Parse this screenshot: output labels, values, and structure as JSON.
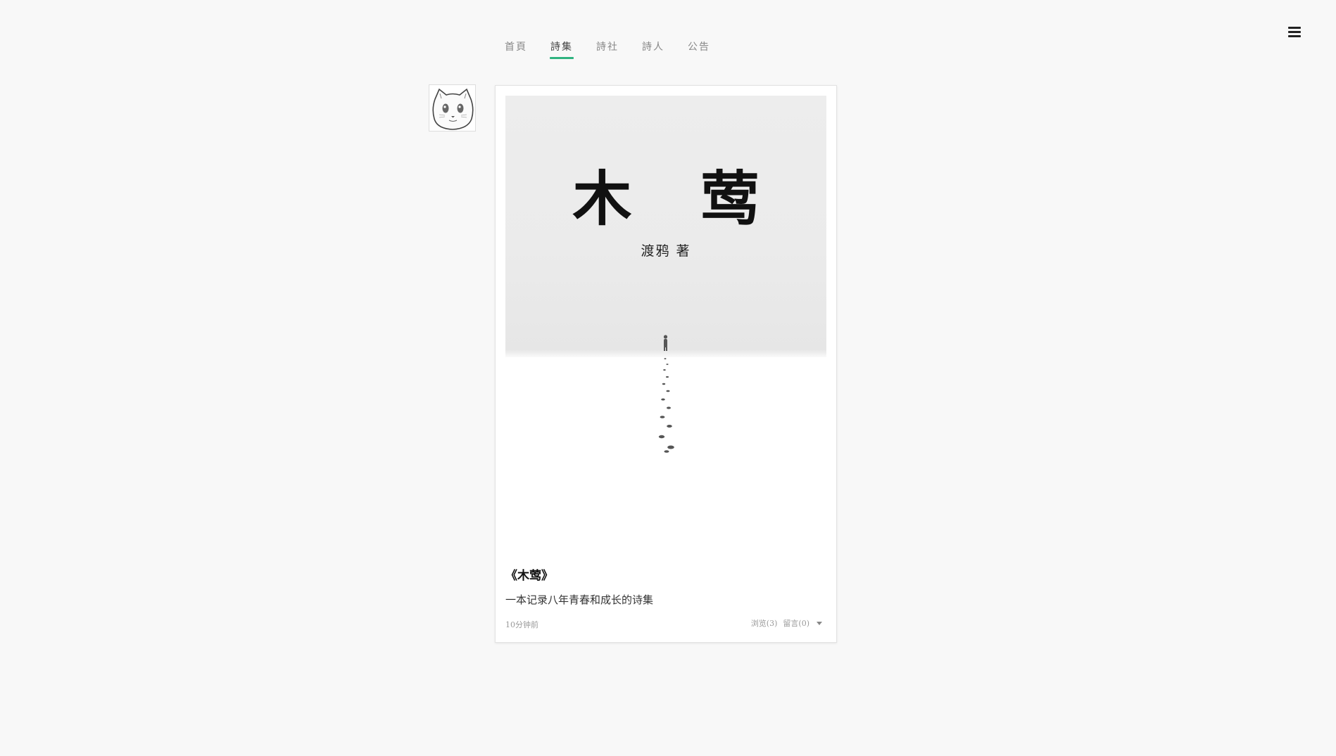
{
  "nav": {
    "items": [
      {
        "label": "首頁"
      },
      {
        "label": "詩集"
      },
      {
        "label": "詩社"
      },
      {
        "label": "詩人"
      },
      {
        "label": "公告"
      }
    ],
    "active_index": 1
  },
  "header": {
    "menu_icon": "hamburger-menu-icon"
  },
  "avatar": {
    "icon": "cat-avatar-icon"
  },
  "card": {
    "cover": {
      "title": "木 莺",
      "author": "渡鸦 著"
    },
    "title": "《木莺》",
    "description": "一本记录八年青春和成长的诗集",
    "time": "10分钟前",
    "views": "浏览(3)",
    "comments": "留言(0)",
    "dropdown_icon": "caret-down-icon"
  },
  "colors": {
    "accent": "#2fb380",
    "background": "#f8f8f8"
  }
}
